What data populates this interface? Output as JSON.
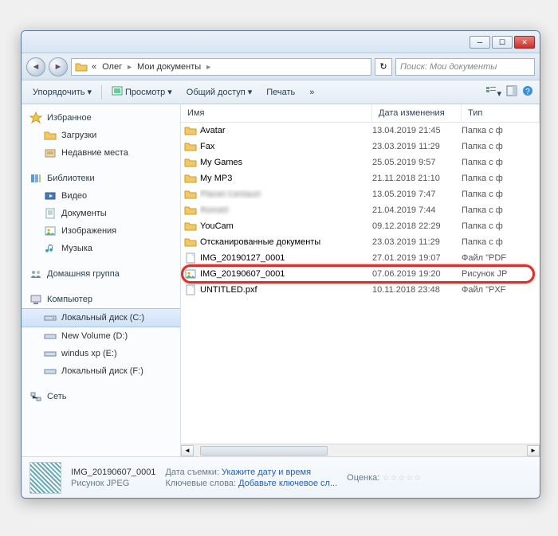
{
  "titlebar": {
    "min": "─",
    "max": "☐",
    "close": "✕"
  },
  "nav": {
    "back": "◄",
    "fwd": "►"
  },
  "breadcrumbs": {
    "root_icon": "«",
    "parts": [
      "Олег",
      "Мои документы"
    ],
    "sep": "►"
  },
  "refresh": "↻",
  "search": {
    "placeholder": "Поиск: Мои документы"
  },
  "toolbar": {
    "organize": "Упорядочить",
    "preview": "Просмотр",
    "share": "Общий доступ",
    "print": "Печать",
    "more": "»"
  },
  "sidebar": {
    "favorites": {
      "label": "Избранное",
      "items": [
        "Загрузки",
        "Недавние места"
      ]
    },
    "libraries": {
      "label": "Библиотеки",
      "items": [
        "Видео",
        "Документы",
        "Изображения",
        "Музыка"
      ]
    },
    "homegroup": {
      "label": "Домашняя группа"
    },
    "computer": {
      "label": "Компьютер",
      "items": [
        "Локальный диск (C:)",
        "New Volume (D:)",
        "windus xp (E:)",
        "Локальный диск (F:)"
      ]
    },
    "network": {
      "label": "Сеть"
    }
  },
  "columns": {
    "name": "Имя",
    "date": "Дата изменения",
    "type": "Тип"
  },
  "files": [
    {
      "icon": "folder",
      "name": "Avatar",
      "date": "13.04.2019 21:45",
      "type": "Папка с ф"
    },
    {
      "icon": "folder",
      "name": "Fax",
      "date": "23.03.2019 11:29",
      "type": "Папка с ф"
    },
    {
      "icon": "folder",
      "name": "My Games",
      "date": "25.05.2019 9:57",
      "type": "Папка с ф"
    },
    {
      "icon": "folder",
      "name": "My MP3",
      "date": "21.11.2018 21:10",
      "type": "Папка с ф"
    },
    {
      "icon": "folder",
      "name": "Planet Centauri",
      "date": "13.05.2019 7:47",
      "type": "Папка с ф",
      "blur": true
    },
    {
      "icon": "folder",
      "name": "RomeII",
      "date": "21.04.2019 7:44",
      "type": "Папка с ф",
      "blur": true
    },
    {
      "icon": "folder",
      "name": "YouCam",
      "date": "09.12.2018 22:29",
      "type": "Папка с ф"
    },
    {
      "icon": "folder",
      "name": "Отсканированные документы",
      "date": "23.03.2019 11:29",
      "type": "Папка с ф"
    },
    {
      "icon": "file",
      "name": "IMG_20190127_0001",
      "date": "27.01.2019 19:07",
      "type": "Файл \"PDF"
    },
    {
      "icon": "image",
      "name": "IMG_20190607_0001",
      "date": "07.06.2019 19:20",
      "type": "Рисунок JP",
      "highlighted": true
    },
    {
      "icon": "file",
      "name": "UNTITLED.pxf",
      "date": "10.11.2018 23:48",
      "type": "Файл \"PXF"
    }
  ],
  "details": {
    "filename": "IMG_20190607_0001",
    "filetype": "Рисунок JPEG",
    "date_label": "Дата съемки:",
    "date_value": "Укажите дату и время",
    "keywords_label": "Ключевые слова:",
    "keywords_value": "Добавьте ключевое сл...",
    "rating_label": "Оценка:",
    "rating_value": "☆☆☆☆☆"
  }
}
